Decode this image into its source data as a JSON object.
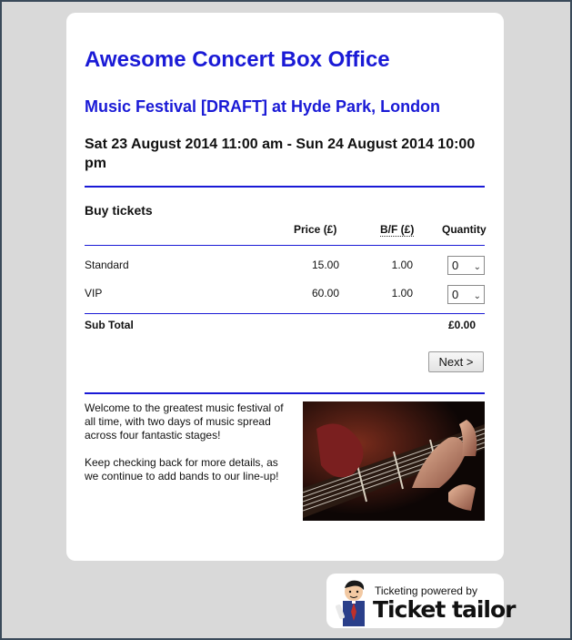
{
  "header": {
    "box_office_title": "Awesome Concert Box Office",
    "event_title": "Music Festival [DRAFT] at Hyde Park, London",
    "event_date": "Sat 23 August 2014 11:00 am - Sun 24 August 2014 10:00 pm"
  },
  "tickets": {
    "section_title": "Buy tickets",
    "columns": {
      "price": "Price (£)",
      "bf": "B/F (£)",
      "quantity": "Quantity"
    },
    "rows": [
      {
        "name": "Standard",
        "price": "15.00",
        "bf": "1.00",
        "quantity": "0"
      },
      {
        "name": "VIP",
        "price": "60.00",
        "bf": "1.00",
        "quantity": "0"
      }
    ],
    "subtotal_label": "Sub Total",
    "subtotal_value": "£0.00",
    "next_label": "Next >"
  },
  "description": {
    "paragraph1": "Welcome to the greatest music festival of all time, with two days of music spread across four fantastic stages!",
    "paragraph2": "Keep checking back for more details, as we continue to add bands to our line-up!"
  },
  "footer": {
    "powered_by": "Ticketing powered by",
    "brand": "Ticket tailor"
  },
  "colors": {
    "accent": "#1a1ad6",
    "background": "#d9d9d9"
  }
}
